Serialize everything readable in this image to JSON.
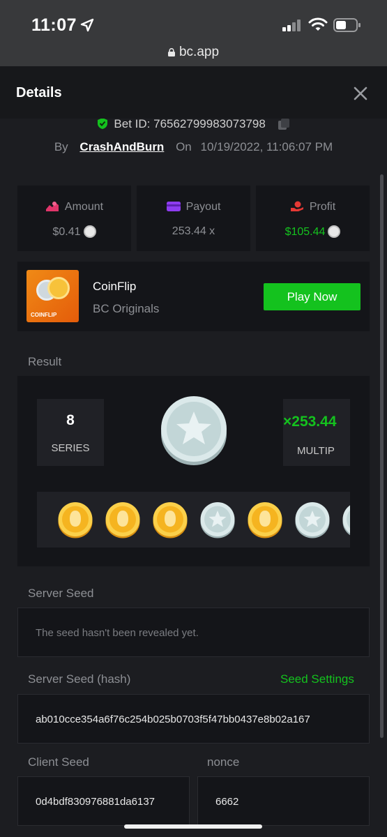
{
  "status": {
    "time": "11:07",
    "url": "bc.app"
  },
  "header": {
    "title": "Details"
  },
  "bet": {
    "id_label": "Bet ID: 76562799983073798",
    "by_label": "By",
    "user": "CrashAndBurn",
    "on_label": "On",
    "date": "10/19/2022, 11:06:07 PM"
  },
  "stats": {
    "amount": {
      "label": "Amount",
      "value": "$0.41"
    },
    "payout": {
      "label": "Payout",
      "value": "253.44 x"
    },
    "profit": {
      "label": "Profit",
      "value": "$105.44"
    }
  },
  "game": {
    "thumb_text": "COINFLIP",
    "name": "CoinFlip",
    "provider": "BC Originals",
    "play_label": "Play Now"
  },
  "result": {
    "label": "Result",
    "series_value": "8",
    "series_label": "SERIES",
    "multiplier_value": "×253.44",
    "multiplier_label": "MULTIP",
    "flips": [
      "gold",
      "gold",
      "gold",
      "silver",
      "gold",
      "silver",
      "silver"
    ]
  },
  "server_seed": {
    "label": "Server Seed",
    "value": "The seed hasn't been revealed yet."
  },
  "server_seed_hash": {
    "label": "Server Seed (hash)",
    "settings_label": "Seed Settings",
    "value": "ab010cce354a6f76c254b025b0703f5f47bb0437e8b02a167"
  },
  "client_seed": {
    "label": "Client Seed",
    "value": "0d4bdf830976881da6137"
  },
  "nonce": {
    "label": "nonce",
    "value": "6662"
  },
  "colors": {
    "green": "#14c21e",
    "gold": "#f7b928",
    "silver": "#c9dfe0"
  }
}
